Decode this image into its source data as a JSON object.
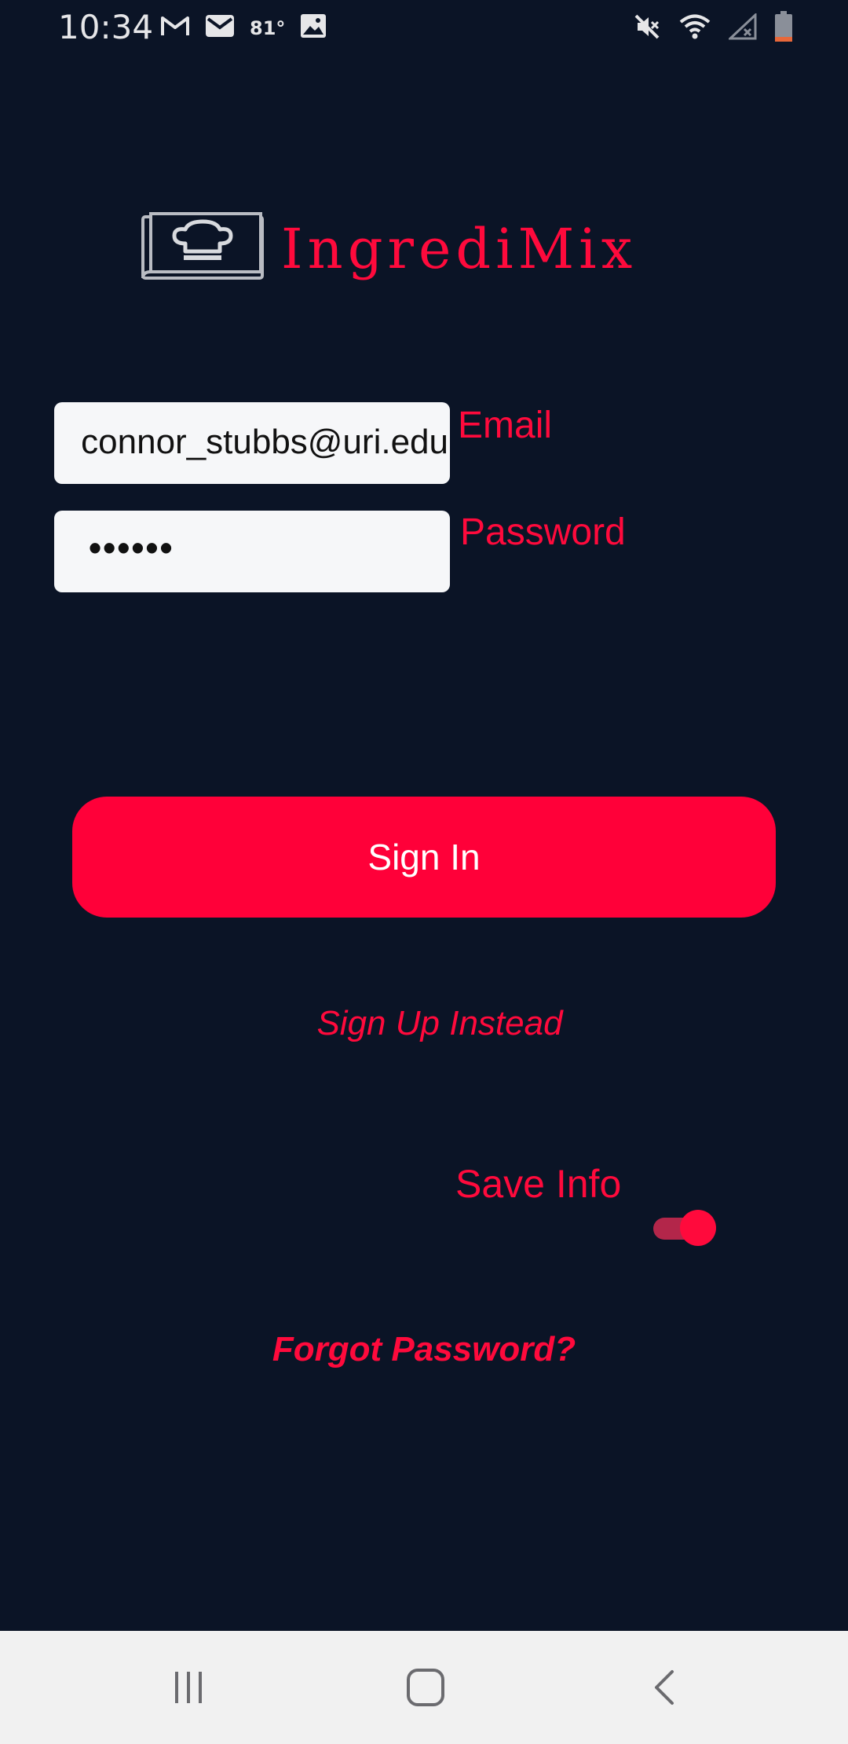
{
  "status_bar": {
    "time": "10:34",
    "temperature": "81°",
    "notification_icons": [
      "gmail-icon",
      "mail-icon",
      "image-icon"
    ],
    "system_icons": [
      "mute-icon",
      "wifi-icon",
      "signal-icon",
      "battery-icon"
    ]
  },
  "app": {
    "name": "IngrediMix",
    "logo_icon": "chef-hat-book-icon"
  },
  "form": {
    "email": {
      "value": "connor_stubbs@uri.edu",
      "label": "Email"
    },
    "password": {
      "value": "••••••",
      "label": "Password"
    }
  },
  "actions": {
    "sign_in_label": "Sign In",
    "sign_up_label": "Sign Up Instead",
    "save_info_label": "Save Info",
    "save_info_enabled": true,
    "forgot_password_label": "Forgot Password?"
  },
  "nav_bar": {
    "buttons": [
      "recent-apps-icon",
      "home-icon",
      "back-icon"
    ]
  },
  "colors": {
    "background": "#0b1426",
    "accent": "#ff0a3c",
    "field_background": "#f6f7f9",
    "nav_background": "#f1f1f1"
  }
}
